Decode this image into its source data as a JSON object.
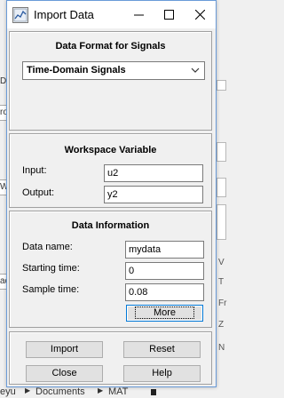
{
  "background": {
    "left_fragments": [
      "D",
      "ro",
      "Wo",
      "ac"
    ],
    "right_fragments": [
      "V",
      "T",
      "Fr",
      "Z",
      "N"
    ],
    "breadcrumb": [
      "eyu",
      "Documents",
      "MAT"
    ]
  },
  "window": {
    "title": "Import Data",
    "accent_color": "#6a9bd8"
  },
  "format_panel": {
    "title": "Data Format for Signals",
    "selected": "Time-Domain Signals"
  },
  "workspace_panel": {
    "title": "Workspace Variable",
    "input_label": "Input:",
    "input_value": "u2",
    "output_label": "Output:",
    "output_value": "y2"
  },
  "info_panel": {
    "title": "Data Information",
    "name_label": "Data name:",
    "name_value": "mydata",
    "start_label": "Starting time:",
    "start_value": "0",
    "sample_label": "Sample time:",
    "sample_value": "0.08",
    "more_label": "More"
  },
  "actions": {
    "import_label": "Import",
    "reset_label": "Reset",
    "close_label": "Close",
    "help_label": "Help"
  }
}
